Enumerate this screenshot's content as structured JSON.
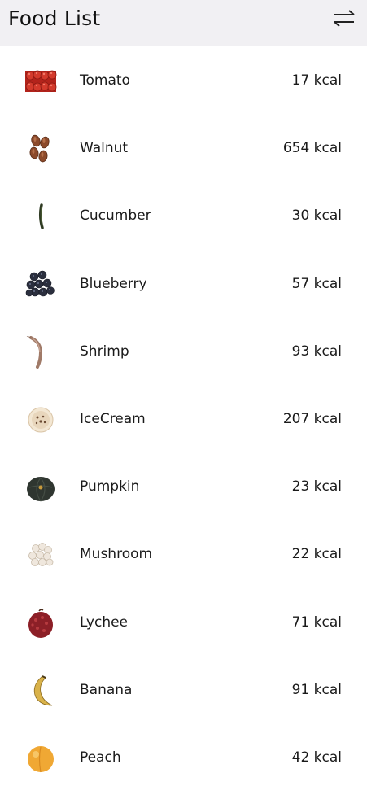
{
  "header": {
    "title": "Food List",
    "sort_icon": "swap-arrows-icon"
  },
  "foods": [
    {
      "name": "Tomato",
      "kcal": "17 kcal",
      "icon": "tomato-icon"
    },
    {
      "name": "Walnut",
      "kcal": "654 kcal",
      "icon": "walnut-icon"
    },
    {
      "name": "Cucumber",
      "kcal": "30 kcal",
      "icon": "cucumber-icon"
    },
    {
      "name": "Blueberry",
      "kcal": "57 kcal",
      "icon": "blueberry-icon"
    },
    {
      "name": "Shrimp",
      "kcal": "93 kcal",
      "icon": "shrimp-icon"
    },
    {
      "name": "IceCream",
      "kcal": "207 kcal",
      "icon": "icecream-icon"
    },
    {
      "name": "Pumpkin",
      "kcal": "23 kcal",
      "icon": "pumpkin-icon"
    },
    {
      "name": "Mushroom",
      "kcal": "22 kcal",
      "icon": "mushroom-icon"
    },
    {
      "name": "Lychee",
      "kcal": "71 kcal",
      "icon": "lychee-icon"
    },
    {
      "name": "Banana",
      "kcal": "91 kcal",
      "icon": "banana-icon"
    },
    {
      "name": "Peach",
      "kcal": "42 kcal",
      "icon": "peach-icon"
    }
  ]
}
